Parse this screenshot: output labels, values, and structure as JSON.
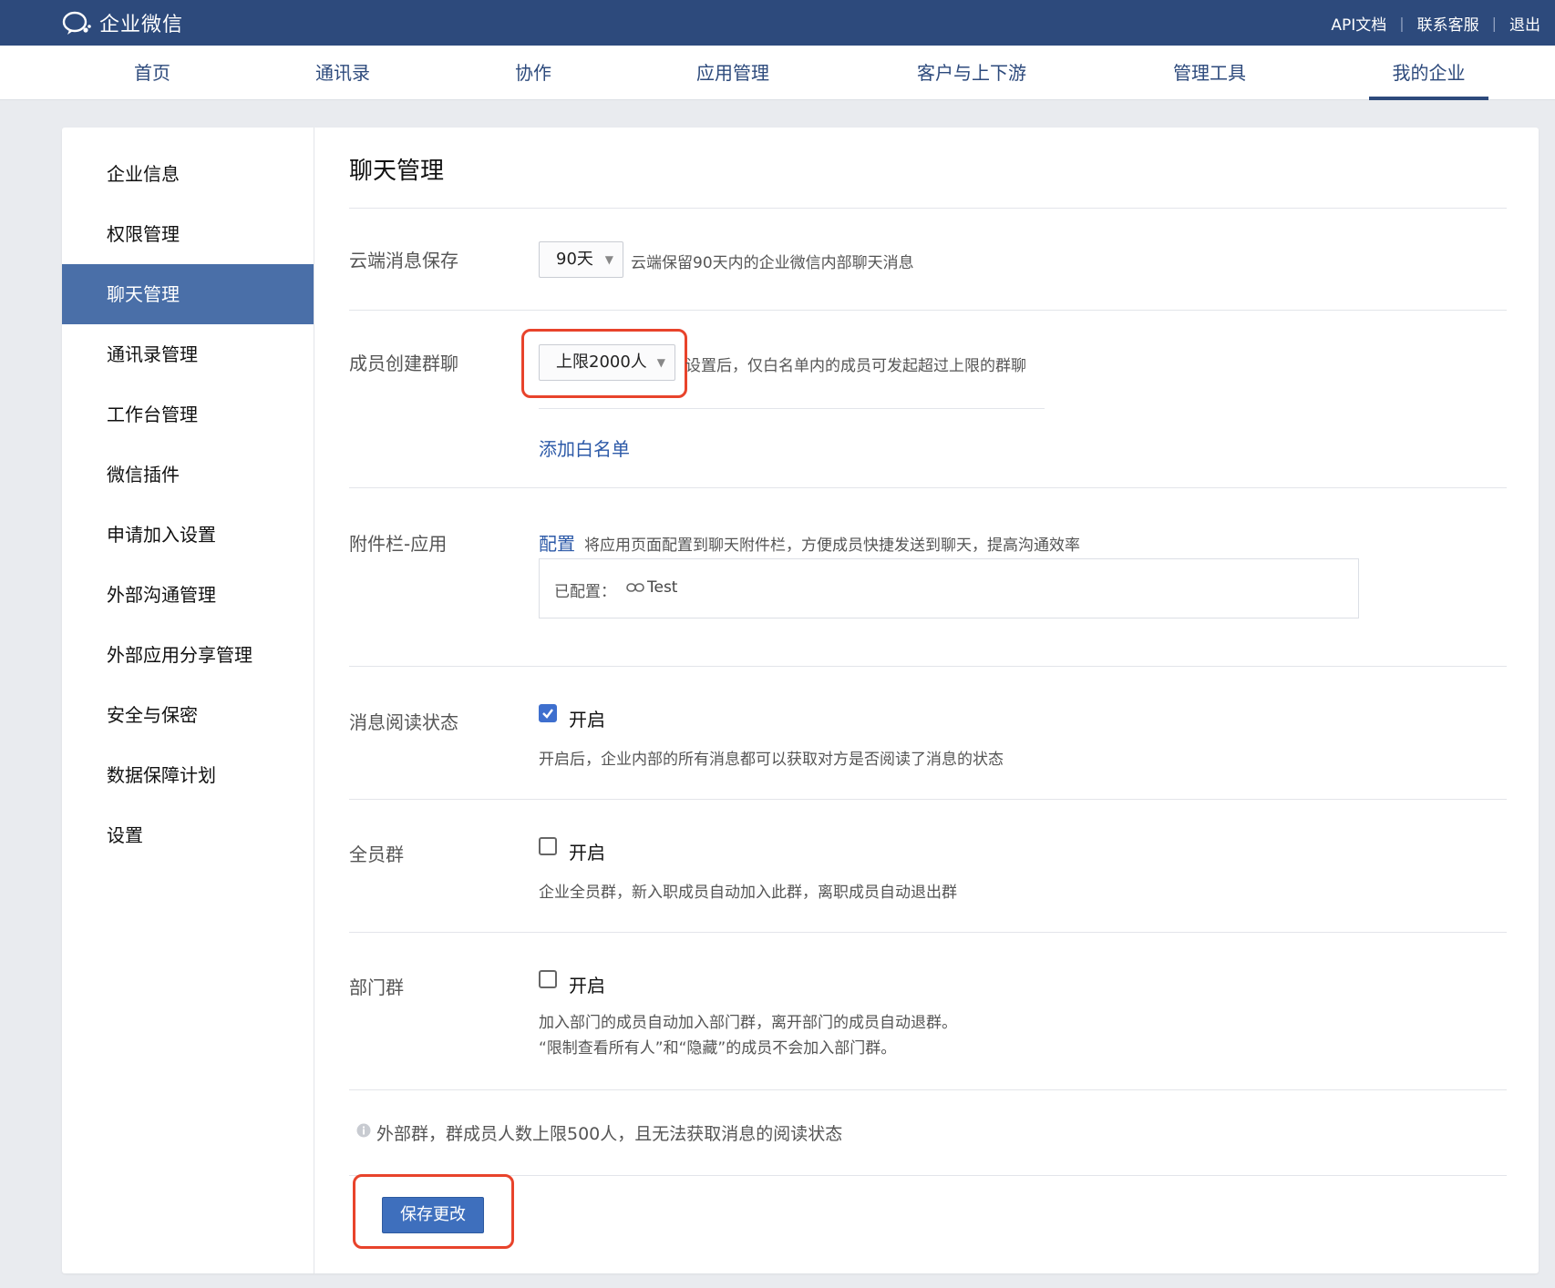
{
  "topbar": {
    "logo_text": "企业微信",
    "links": [
      "API文档",
      "联系客服",
      "退出"
    ]
  },
  "nav": {
    "items": [
      "首页",
      "通讯录",
      "协作",
      "应用管理",
      "客户与上下游",
      "管理工具",
      "我的企业"
    ],
    "active_index": 6
  },
  "sidebar": {
    "items": [
      "企业信息",
      "权限管理",
      "聊天管理",
      "通讯录管理",
      "工作台管理",
      "微信插件",
      "申请加入设置",
      "外部沟通管理",
      "外部应用分享管理",
      "安全与保密",
      "数据保障计划",
      "设置"
    ],
    "active_index": 2
  },
  "content": {
    "title": "聊天管理",
    "cloud_storage": {
      "label": "云端消息保存",
      "value": "90天",
      "desc": "云端保留90天内的企业微信内部聊天消息"
    },
    "group_create": {
      "label": "成员创建群聊",
      "value": "上限2000人",
      "desc": "设置后，仅白名单内的成员可发起超过上限的群聊",
      "whitelist_link": "添加白名单"
    },
    "attachment": {
      "label": "附件栏-应用",
      "config_link": "配置",
      "desc": "将应用页面配置到聊天附件栏，方便成员快捷发送到聊天，提高沟通效率",
      "configured_label": "已配置：",
      "configured_item": "Test"
    },
    "read_status": {
      "label": "消息阅读状态",
      "checked": true,
      "option": "开启",
      "desc": "开启后，企业内部的所有消息都可以获取对方是否阅读了消息的状态"
    },
    "all_member_group": {
      "label": "全员群",
      "checked": false,
      "option": "开启",
      "desc": "企业全员群，新入职成员自动加入此群，离职成员自动退出群"
    },
    "dept_group": {
      "label": "部门群",
      "checked": false,
      "option": "开启",
      "desc_line1": "加入部门的成员自动加入部门群，离开部门的成员自动退群。",
      "desc_line2": "“限制查看所有人”和“隐藏”的成员不会加入部门群。"
    },
    "notice": "外部群，群成员人数上限500人，且无法获取消息的阅读状态",
    "save_label": "保存更改"
  },
  "colors": {
    "topbar": "#2d4a7c",
    "sidebar_active": "#4a6fa8",
    "highlight_box": "#e8432b",
    "primary_button": "#3e6fbd"
  }
}
